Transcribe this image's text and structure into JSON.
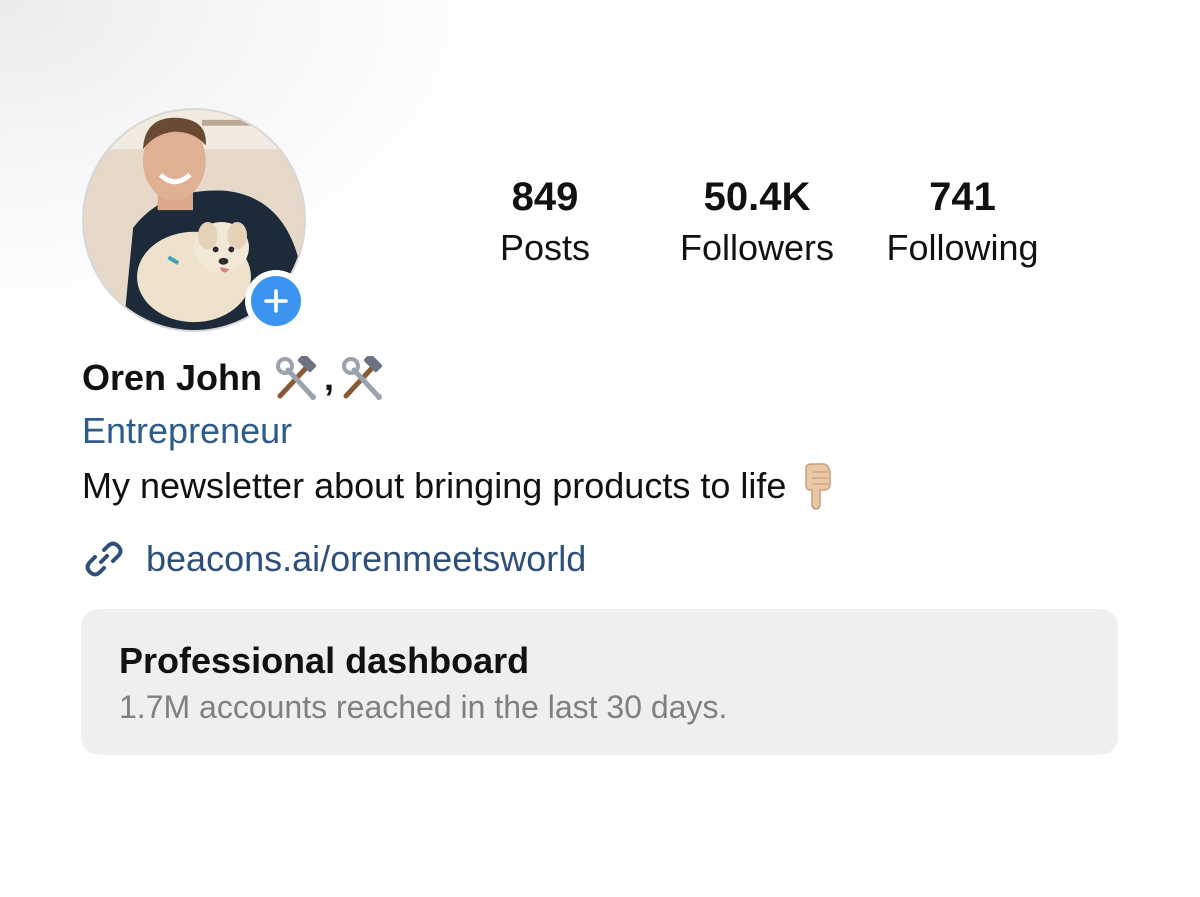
{
  "profile": {
    "name": "Oren John",
    "category": "Entrepreneur",
    "bio": "My newsletter about bringing products to life",
    "link": "beacons.ai/orenmeetsworld"
  },
  "stats": {
    "posts": {
      "value": "849",
      "label": "Posts"
    },
    "followers": {
      "value": "50.4K",
      "label": "Followers"
    },
    "following": {
      "value": "741",
      "label": "Following"
    }
  },
  "dashboard": {
    "title": "Professional dashboard",
    "subtitle": "1.7M accounts reached in the last 30 days."
  },
  "icons": {
    "name_emoji": [
      "hammer-and-wrench-icon",
      "hammer-and-wrench-icon"
    ],
    "bio_emoji": "point-down-icon",
    "link": "link-icon",
    "add_story": "plus-icon"
  },
  "colors": {
    "accent_blue": "#3b95f0",
    "category_blue": "#2d5b8a",
    "link_blue": "#2d4f7a",
    "dashboard_bg": "#efefef"
  }
}
